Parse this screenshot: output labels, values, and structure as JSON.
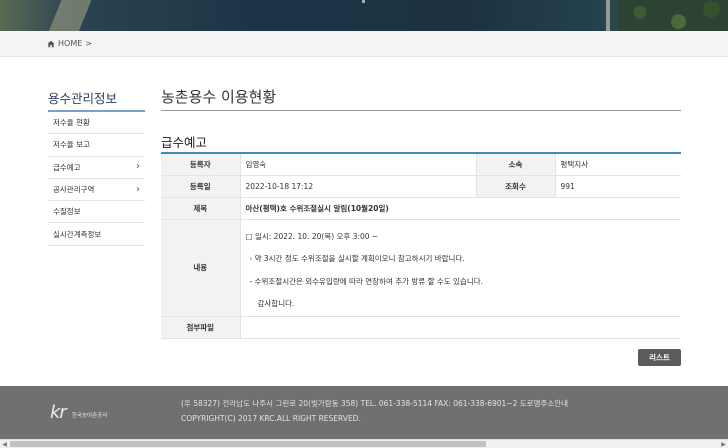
{
  "breadcrumb": {
    "home": "HOME",
    "sep": ">"
  },
  "sidebar": {
    "title": "용수관리정보",
    "items": [
      {
        "label": "저수율 현황",
        "chevron": ""
      },
      {
        "label": "저수율 보고",
        "chevron": ""
      },
      {
        "label": "급수예고",
        "chevron": "›"
      },
      {
        "label": "공사관리구역",
        "chevron": "›"
      },
      {
        "label": "수질정보",
        "chevron": ""
      },
      {
        "label": "실시간계측정보",
        "chevron": ""
      }
    ]
  },
  "main": {
    "title": "농촌용수 이용현황",
    "section_title": "급수예고",
    "fields": {
      "author_label": "등록자",
      "author": "임영숙",
      "office_label": "소속",
      "office": "평택지사",
      "date_label": "등록일",
      "date": "2022-10-18 17:12",
      "views_label": "조회수",
      "views": "991",
      "subject_label": "제목",
      "subject": "아산(평택)호 수위조절실시 알림(10월20일)",
      "content_label": "내용",
      "content_lines": [
        "□ 일시: 2022. 10. 20(목)  오후 3:00 ~",
        " - 약 3시간 정도 수위조절을 실시할 계획이오니 참고하시기 바랍니다.",
        " - 수위조절시간은 외수유입량에 따라 연장하여 추가 방류 할 수도 있습니다.",
        "감사합니다."
      ],
      "attach_label": "첨부파일"
    },
    "list_button": "리스트"
  },
  "footer": {
    "logo_mark": "kr",
    "logo_text": "한국농어촌공사",
    "address": "(우 58327) 전라남도 나주시 그린로 20(빛가람동 358)   TEL. 061-338-5114   FAX: 061-338-6901~2   도로명주소안내",
    "copyright": "COPYRIGHT(C) 2017 KRC.ALL RIGHT RESERVED."
  },
  "colors": {
    "accent": "#3c8dbc",
    "sidebar_title": "#2c3e66",
    "footer_bg": "#707070",
    "button_bg": "#5b5b5b"
  },
  "icons": {
    "home": "home-icon",
    "chevron": "chevron-right-icon"
  }
}
